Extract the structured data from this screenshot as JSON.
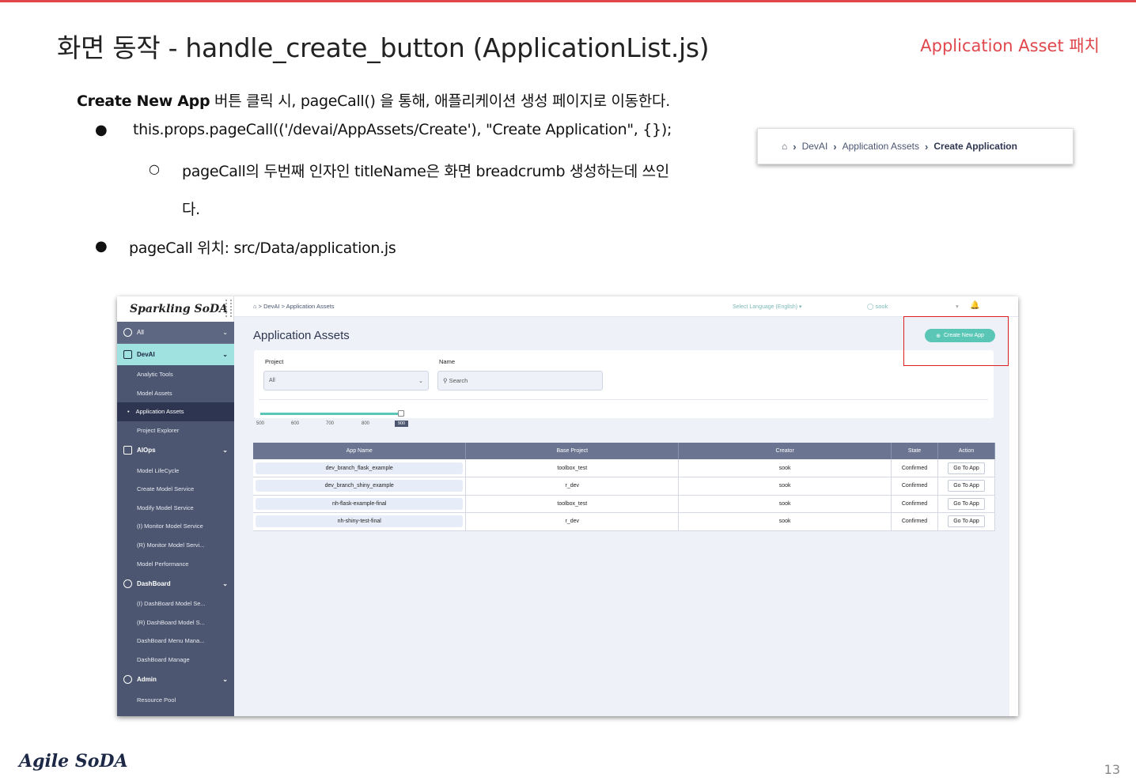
{
  "slide": {
    "title": "화면 동작 - handle_create_button  (ApplicationList.js)",
    "tag": "Application Asset 패치",
    "page_number": "13",
    "footer_logo": "Agile SoDA"
  },
  "body": {
    "intro_bold": "Create New App",
    "intro_rest": " 버튼 클릭 시, pageCall() 을 통해, 애플리케이션 생성 페이지로 이동한다.",
    "bullet1": "this.props.pageCall(('/devai/AppAssets/Create'), \"Create Application\", {});",
    "sub_bullet_line1": "pageCall의 두번째 인자인 titleName은 화면 breadcrumb 생성하는데 쓰인",
    "sub_bullet_line2": "다.",
    "bullet2": "pageCall 위치: src/Data/application.js",
    "bullet_glyph": "●",
    "sub_bullet_glyph": "○"
  },
  "breadcrumb_callout": {
    "home_icon": "home-icon",
    "items": [
      "DevAI",
      "Application Assets"
    ],
    "current": "Create Application"
  },
  "app": {
    "logo": "Sparkling SoDA",
    "topbar": {
      "crumb": "⌂ > DevAI > Application Assets",
      "language": "Select Language (English) ▾",
      "user": "sook",
      "dropdown": "▾",
      "bell_icon": "bell-icon"
    },
    "sidebar": {
      "workspace_select": "All",
      "groups": [
        {
          "label": "DevAI",
          "active": true,
          "items": [
            "Analytic Tools",
            "Model Assets",
            "Application Assets",
            "Project Explorer"
          ],
          "active_item": "Application Assets"
        },
        {
          "label": "AIOps",
          "items": [
            "Model LifeCycle",
            "Create Model Service",
            "Modify Model Service",
            "(I) Monitor Model Service",
            "(R) Monitor Model Servi...",
            "Model Performance"
          ]
        },
        {
          "label": "DashBoard",
          "items": [
            "(I) DashBoard Model Se...",
            "(R) DashBoard Model S...",
            "DashBoard Menu Mana...",
            "DashBoard Manage"
          ]
        },
        {
          "label": "Admin",
          "items": [
            "Resource Pool"
          ]
        }
      ]
    },
    "page_title": "Application Assets",
    "create_button": "Create New App",
    "filters": {
      "project_label": "Project",
      "project_value": "All",
      "name_label": "Name",
      "search_placeholder": "Search"
    },
    "slider": {
      "ticks": [
        "500",
        "600",
        "700",
        "800"
      ],
      "value": "900"
    },
    "table": {
      "columns": [
        "App Name",
        "Base Project",
        "Creator",
        "State",
        "Action"
      ],
      "rows": [
        [
          "dev_branch_flask_example",
          "toolbox_test",
          "sook",
          "Confirmed",
          "Go To App"
        ],
        [
          "dev_branch_shiny_example",
          "r_dev",
          "sook",
          "Confirmed",
          "Go To App"
        ],
        [
          "nh-flask-example-final",
          "toolbox_test",
          "sook",
          "Confirmed",
          "Go To App"
        ],
        [
          "nh-shiny-test-final",
          "r_dev",
          "sook",
          "Confirmed",
          "Go To App"
        ]
      ]
    }
  },
  "colors": {
    "accent_red": "#e0474c",
    "sidebar": "#4c5670",
    "sidebar_active_group": "#9fe2e0",
    "teal_button": "#5ac6b6"
  }
}
